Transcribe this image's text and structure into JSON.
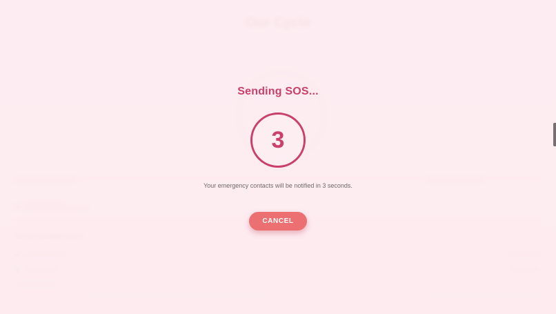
{
  "background": {
    "app_title": "Our Cycle",
    "section_title": "Predicted Milestones"
  },
  "sos": {
    "title": "Sending SOS...",
    "countdown": "3",
    "message": "Your emergency contacts will be notified in 3 seconds.",
    "cancel_label": "CANCEL"
  },
  "colors": {
    "accent": "#c9406a",
    "button": "#ec6f72",
    "background": "#fdeef1"
  }
}
